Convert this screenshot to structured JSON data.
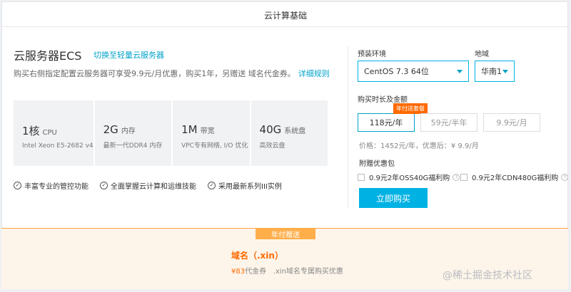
{
  "section_title": "云计算基础",
  "product": {
    "title": "云服务器ECS",
    "switch_link": "切换至轻量云服务器",
    "promo": "购买右侧指定配置云服务器可享受9.9元/月优惠，购买1年，另赠送 域名代金券。",
    "promo_link": "详细规则"
  },
  "specs": [
    {
      "value": "1核",
      "unit": "CPU",
      "desc": "Intel Xeon E5-2682 v4"
    },
    {
      "value": "2G",
      "unit": "内存",
      "desc": "最新一代DDR4 内存"
    },
    {
      "value": "1M",
      "unit": "带宽",
      "desc": "VPC专有网络, I/O 优化"
    },
    {
      "value": "40G",
      "unit": "系统盘",
      "desc": "高效云盘"
    }
  ],
  "features": [
    "丰富专业的管控功能",
    "全面掌握云计算和运维技能",
    "采用最新系列III实例"
  ],
  "env": {
    "label": "预装环境",
    "value": "CentOS 7.3 64位"
  },
  "region": {
    "label": "地域",
    "value": "华南1"
  },
  "duration": {
    "label": "购买时长及金额",
    "badge": "年付送套餐",
    "options": [
      "118元/年",
      "59元/半年",
      "9.9元/月"
    ]
  },
  "price_line": "价格：1452元/年，优惠后：¥ 9.9/月",
  "addons": {
    "title": "附赠优惠包",
    "items": [
      "0.9元2年OSS40G福利购",
      "0.9元2年CDN480G福利购"
    ]
  },
  "buy_button": "立即购买",
  "gift": {
    "tag": "年付赠送",
    "title": "域名（.xin）",
    "amount": "¥83",
    "amount_suffix": "代金券",
    "desc": ".xin域名专属购买优惠"
  },
  "watermark": "@稀土掘金技术社区",
  "colors": {
    "accent": "#00b2e3",
    "link": "#00a2ca",
    "orange": "#ff6a00"
  }
}
